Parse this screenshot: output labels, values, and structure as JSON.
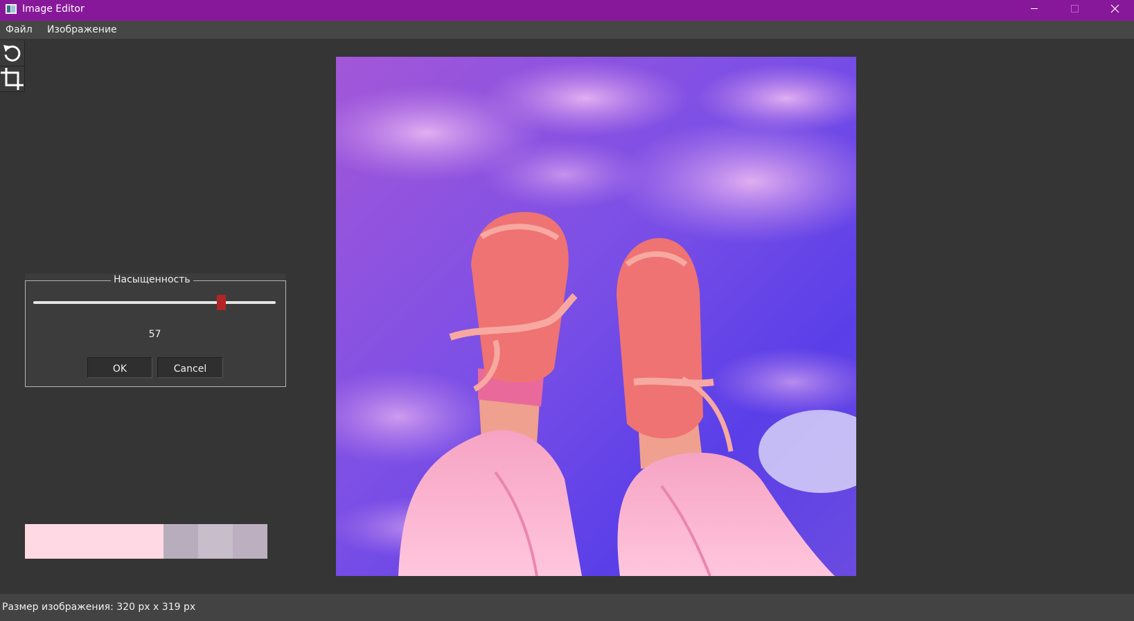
{
  "window": {
    "title": "Image Editor",
    "titlebar_color": "#88189a",
    "controls": [
      "minimize-icon",
      "maximize-icon",
      "close-icon"
    ]
  },
  "menu": {
    "items": [
      {
        "label": "Файл"
      },
      {
        "label": "Изображение"
      }
    ]
  },
  "toolbar": {
    "tools": [
      {
        "icon": "rotate-icon"
      },
      {
        "icon": "crop-icon"
      }
    ]
  },
  "saturation": {
    "title": "Насыщенность",
    "value": "57",
    "level": 0.775,
    "ok_label": "OK",
    "cancel_label": "Cancel"
  },
  "palette": {
    "swatches": [
      {
        "color": "#ffd9e3",
        "weight": 4
      },
      {
        "color": "#b8adbd",
        "weight": 1
      },
      {
        "color": "#c8bdcb",
        "weight": 1
      },
      {
        "color": "#bcafc0",
        "weight": 1
      }
    ]
  },
  "image": {
    "subject": "pink-sneakers-against-purple-sky"
  },
  "status": {
    "text": "Размер изображения: 320 px x 319 px"
  }
}
